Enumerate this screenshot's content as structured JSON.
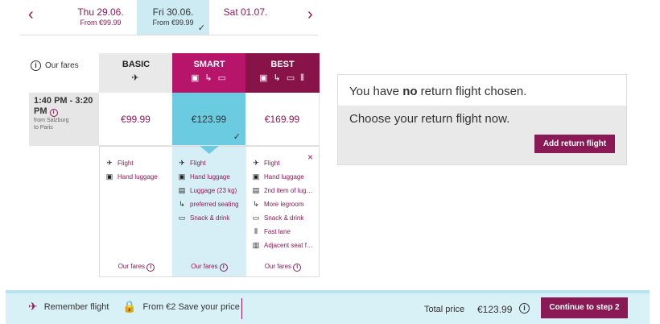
{
  "dates": [
    {
      "day": "Thu 29.06.",
      "price": "From €99.99",
      "selected": false
    },
    {
      "day": "Fri 30.06.",
      "price": "From €99.99",
      "selected": true
    },
    {
      "day": "Sat 01.07.",
      "price": "",
      "selected": false
    }
  ],
  "nav": {
    "prev": "‹",
    "next": "›"
  },
  "fares_label": "Our fares",
  "fare_heads": [
    {
      "name": "BASIC",
      "icons": "✈"
    },
    {
      "name": "SMART",
      "icons": "▣ ↳ ▭"
    },
    {
      "name": "BEST",
      "icons": "▣ ↳ ▭ ⫴"
    }
  ],
  "flight": {
    "time": "1:40 PM - 3:20 PM",
    "route_from": "from Salzburg",
    "route_to": "to Paris"
  },
  "prices": [
    "€99.99",
    "€123.99",
    "€169.99"
  ],
  "checkmark": "✓",
  "details": {
    "basic": [
      "Flight",
      "Hand luggage"
    ],
    "smart": [
      "Flight",
      "Hand luggage",
      "Luggage (23 kg)",
      "preferred seating",
      "Snack & drink"
    ],
    "best": [
      "Flight",
      "Hand luggage",
      "2nd item of lug…",
      "More legroom",
      "Snack & drink",
      "Fast lane",
      "Adjacent seat f…"
    ],
    "our_fares": "Our fares",
    "close": "×"
  },
  "return": {
    "line1_pre": "You have ",
    "line1_bold": "no",
    "line1_post": " return flight chosen.",
    "line2": "Choose your return flight now.",
    "button": "Add return flight"
  },
  "bottom": {
    "remember": "Remember flight",
    "save_price": "From €2 Save your price",
    "total_label": "Total price",
    "total_value": "€123.99",
    "continue": "Continue to step 2"
  },
  "colors": {
    "brand": "#8a1a55",
    "smart": "#b7156a",
    "best": "#881348",
    "highlight": "#6bcbe0"
  }
}
